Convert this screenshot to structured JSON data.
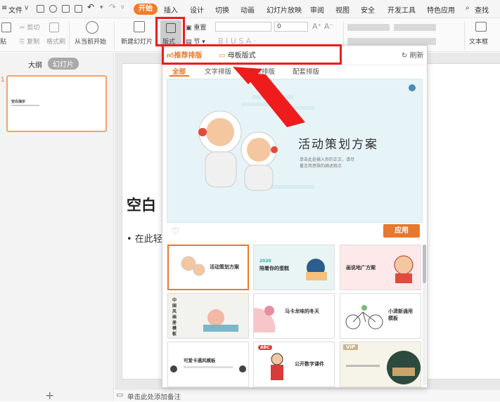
{
  "menubar": {
    "file": "文件",
    "tabs": [
      "开始",
      "插入",
      "设计",
      "切换",
      "动画",
      "幻灯片放映",
      "审阅",
      "视图",
      "安全",
      "开发工具",
      "特色应用"
    ],
    "search": "查找"
  },
  "ribbon": {
    "paste": "贴",
    "cut": "剪切",
    "copy": "复制",
    "format_painter": "格式刷",
    "play_from_current": "从当前开始",
    "new_slide": "新建幻灯片",
    "layout": "版式",
    "reset": "重置",
    "section": "节",
    "font_size": "0",
    "text_box": "文本框"
  },
  "left_panel": {
    "outline": "大纲",
    "slides": "幻灯片",
    "slide_number": "1",
    "thumb_text": "空白演示"
  },
  "slide": {
    "title_partial": "空白",
    "bullet_partial": "• 在此轻"
  },
  "bottom": {
    "add_slide": "+",
    "notes": "单击此处添加备注"
  },
  "popup": {
    "tab_recommended": "推荐排版",
    "tab_master": "母板版式",
    "refresh": "刷新",
    "subtabs": [
      "全部",
      "文字排版",
      "图示排版",
      "配套排版"
    ],
    "preview_title": "活动策划方案",
    "preview_sub1": "单击此处输入你的正文，请尽",
    "preview_sub2": "量言简意赅的阐述观点",
    "apply": "应用",
    "thumbs": [
      {
        "title": "活动策划方案"
      },
      {
        "title": "陪着你的蛋糕",
        "sub": "2020"
      },
      {
        "title": "画说地广方案"
      },
      {
        "title": "中国风画册模板"
      },
      {
        "title": "马卡龙味的冬天"
      },
      {
        "title": "小清新通用模板"
      },
      {
        "title": "可爱卡通风模板"
      },
      {
        "title": "公开数字课件",
        "sub": "ABC"
      },
      {
        "title": "VIP"
      }
    ]
  },
  "colors": {
    "accent": "#f07b2a",
    "annotation": "#ee1c1c"
  }
}
